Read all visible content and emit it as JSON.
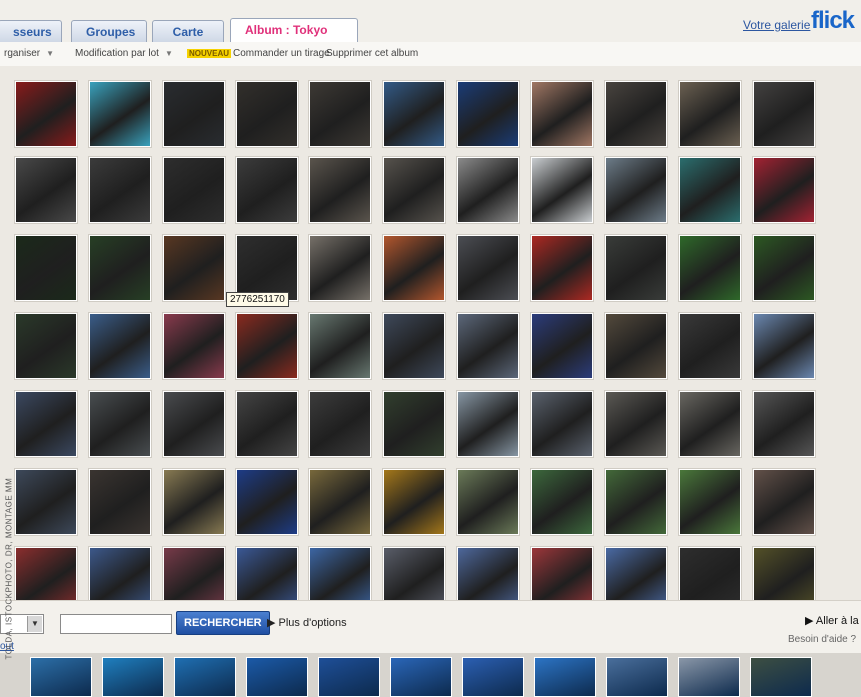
{
  "tabs": [
    {
      "label": "sseurs"
    },
    {
      "label": "Groupes"
    },
    {
      "label": "Carte"
    },
    {
      "label": "Album : Tokyo"
    }
  ],
  "close_icon": "×",
  "gallery_link": "Votre galerie",
  "logo": {
    "part1": "flick"
  },
  "menu": {
    "organize": "rganiser",
    "batch_edit": "Modification par lot",
    "new_badge": "NOUVEAU",
    "order_print": "Commander un tirage",
    "delete_album": "Supprimer cet album"
  },
  "tooltip": "2776251170",
  "search": {
    "button": "RECHERCHER",
    "more_options": "Plus d'options",
    "goto": "Aller à la c",
    "help": "Besoin d'aide ?",
    "left_link": "out"
  },
  "credit": "TOLDA, ISTOCKPHOTO, DR, MONTAGE MM",
  "colors": {
    "tab_active_text": "#e0307a",
    "link_blue": "#2c56a0",
    "button_blue": "#1f4fa2"
  },
  "photos": [
    [
      "#8c1b1b",
      "#3aa6c2",
      "#2a2d31",
      "#33302c",
      "#3e3a35",
      "#335c8a",
      "#1a3d7a",
      "#a57a66",
      "#4a4540",
      "#6d6253",
      "#444241"
    ],
    [
      "#4a4a4a",
      "#3c3c3c",
      "#2e2e2e",
      "#3d3d3d",
      "#5c564e",
      "#58544e",
      "#8e8e8e",
      "#cfd3d6",
      "#6f7f8c",
      "#2b7070",
      "#a72233"
    ],
    [
      "#1b2a1a",
      "#274025",
      "#5a3822",
      "#2f2f2f",
      "#79736b",
      "#b7582e",
      "#4d4f55",
      "#b12922",
      "#3a3d3a",
      "#2f6b2a",
      "#2d5a23"
    ],
    [
      "#2b3a2a",
      "#3b5f8d",
      "#8c3b4e",
      "#8e2b1f",
      "#6a7b73",
      "#3f4a5c",
      "#5e6a7d",
      "#2c3d7e",
      "#554b3d",
      "#3a3a3a",
      "#6d8bb5"
    ],
    [
      "#3c4a63",
      "#4a4f52",
      "#4b4d50",
      "#464646",
      "#3d3d3d",
      "#32402e",
      "#8a9aa8",
      "#5c6470",
      "#5d5b56",
      "#6b6963",
      "#585858"
    ],
    [
      "#3e4a5c",
      "#3b3531",
      "#8b7d54",
      "#1e3d8a",
      "#7a6a3c",
      "#a87a1a",
      "#6d7d5a",
      "#3d6a3d",
      "#446b3a",
      "#4b7a3b",
      "#64524a"
    ],
    [
      "#8e2e2e",
      "#3d5a8e",
      "#7a3b4a",
      "#3b5a9a",
      "#3d68a8",
      "#5b5f6b",
      "#4f6aa0",
      "#a0373b",
      "#4b6ca8",
      "#2e2e2e",
      "#555228"
    ]
  ],
  "filmstrip": [
    "#2c6fa8",
    "#1f7fbf",
    "#1f6fb2",
    "#1b5aa8",
    "#1e4f98",
    "#2a66b8",
    "#2b5fb2",
    "#2c74c5",
    "#4a6f9c",
    "#8a97a8",
    "#3d4f42"
  ]
}
